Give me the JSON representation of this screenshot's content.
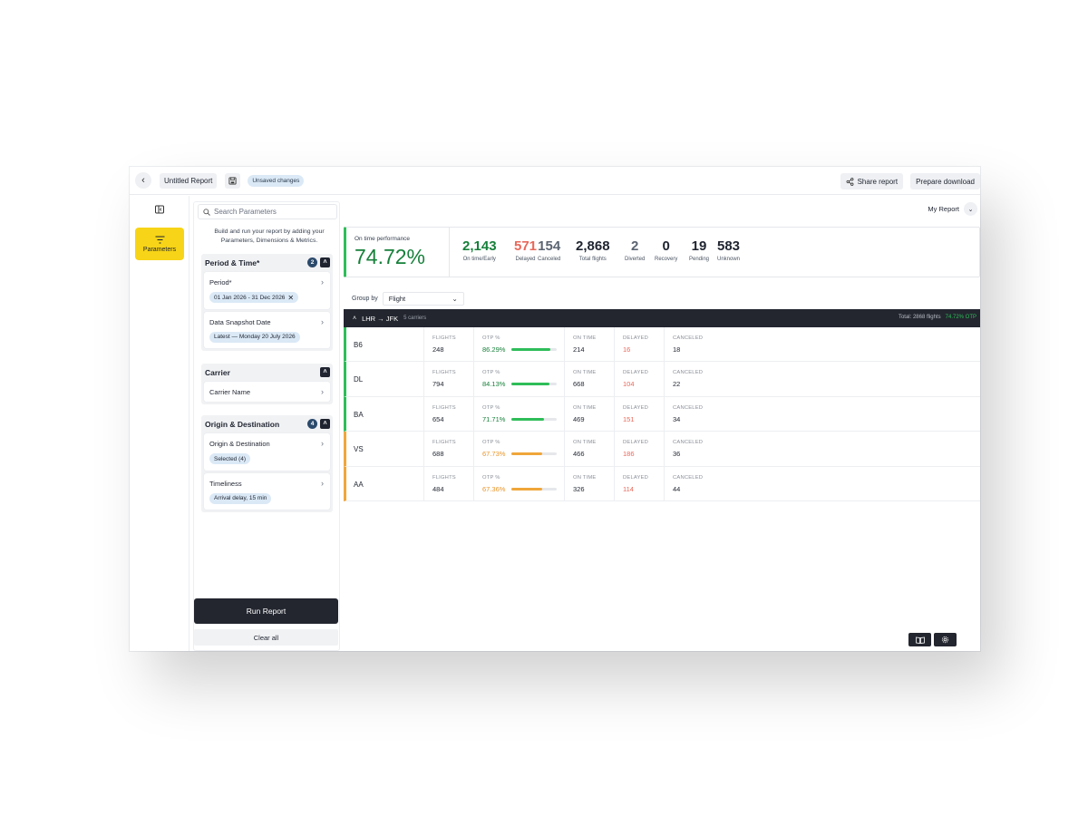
{
  "header": {
    "report_name": "Untitled Report",
    "unsaved": "Unsaved changes",
    "share": "Share report",
    "download": "Prepare download"
  },
  "rail": {
    "params_label": "Parameters"
  },
  "panel": {
    "search_placeholder": "Search Parameters",
    "intro": "Build and run your report by adding your Parameters, Dimensions & Metrics.",
    "groups": [
      {
        "title": "Period & Time*",
        "count": "2",
        "items": [
          {
            "label": "Period*",
            "pill": "01 Jan 2026 - 31 Dec 2026"
          },
          {
            "label": "Data Snapshot Date",
            "pill": "Latest — Monday 20 July 2026"
          }
        ]
      },
      {
        "title": "Carrier",
        "count": "",
        "items": [
          {
            "label": "Carrier Name",
            "pill": ""
          }
        ]
      },
      {
        "title": "Origin & Destination",
        "count": "4",
        "items": [
          {
            "label": "Origin & Destination",
            "pill": "Selected (4)"
          },
          {
            "label": "Timeliness",
            "pill": "Arrival delay, 15 min"
          }
        ]
      }
    ],
    "run": "Run Report",
    "clear": "Clear all"
  },
  "main": {
    "my_report": "My Report",
    "otp_label": "On time performance",
    "otp_value": "74.72%",
    "kpis": [
      {
        "value": "2,143",
        "label": "On time/Early",
        "color": "#16803a"
      },
      {
        "value": "571",
        "label": "Delayed",
        "color": "#e8685a"
      },
      {
        "value": "154",
        "label": "Canceled",
        "color": "#5b6472"
      },
      {
        "value": "2,868",
        "label": "Total flights",
        "color": "#1f2430"
      },
      {
        "value": "2",
        "label": "Diverted",
        "color": "#5b6472"
      },
      {
        "value": "0",
        "label": "Recovery",
        "color": "#1f2430"
      },
      {
        "value": "19",
        "label": "Pending",
        "color": "#1f2430"
      },
      {
        "value": "583",
        "label": "Unknown",
        "color": "#1f2430"
      }
    ],
    "group_by_label": "Group by",
    "group_by_value": "Flight",
    "route": "LHR → JFK",
    "route_sub": "5 carriers",
    "route_total": "Total: 2868 flights",
    "route_otp": "74.72% OTP",
    "col_headers": {
      "flights": "FLIGHTS",
      "otp": "OTP %",
      "on_time": "ON TIME",
      "delayed": "DELAYED",
      "canceled": "CANCELED"
    },
    "rows": [
      {
        "carrier": "B6",
        "flights": "248",
        "otp": "86.29%",
        "otp_frac": 0.8629,
        "on_time": "214",
        "delayed": "16",
        "canceled": "18",
        "status": "good"
      },
      {
        "carrier": "DL",
        "flights": "794",
        "otp": "84.13%",
        "otp_frac": 0.8413,
        "on_time": "668",
        "delayed": "104",
        "canceled": "22",
        "status": "good"
      },
      {
        "carrier": "BA",
        "flights": "654",
        "otp": "71.71%",
        "otp_frac": 0.7171,
        "on_time": "469",
        "delayed": "151",
        "canceled": "34",
        "status": "good"
      },
      {
        "carrier": "VS",
        "flights": "688",
        "otp": "67.73%",
        "otp_frac": 0.6773,
        "on_time": "466",
        "delayed": "186",
        "canceled": "36",
        "status": "warn"
      },
      {
        "carrier": "AA",
        "flights": "484",
        "otp": "67.36%",
        "otp_frac": 0.6736,
        "on_time": "326",
        "delayed": "114",
        "canceled": "44",
        "status": "warn"
      }
    ],
    "colors": {
      "good": "#2ebd59",
      "good_text": "#16803a",
      "warn": "#f0a63a",
      "warn_text": "#e8952a",
      "delayed_text": "#e8685a"
    }
  }
}
